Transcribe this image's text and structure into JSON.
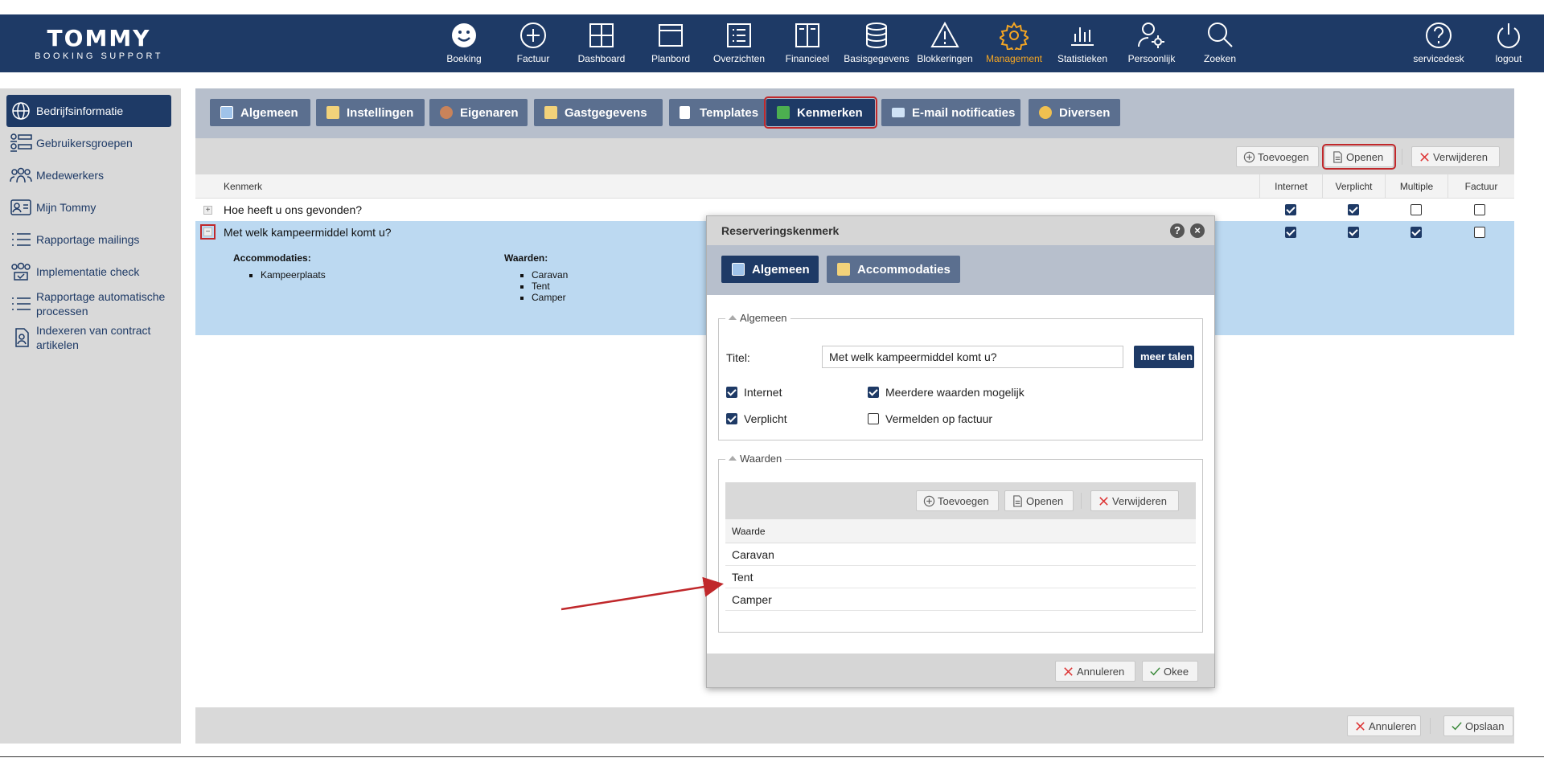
{
  "logo": {
    "main": "TOMMY",
    "sub": "BOOKING SUPPORT"
  },
  "nav": [
    {
      "label": "Boeking",
      "icon": "smiley-icon"
    },
    {
      "label": "Factuur",
      "icon": "plus-circle-icon"
    },
    {
      "label": "Dashboard",
      "icon": "grid-icon"
    },
    {
      "label": "Planbord",
      "icon": "board-icon"
    },
    {
      "label": "Overzichten",
      "icon": "list-icon"
    },
    {
      "label": "Financieel",
      "icon": "book-icon"
    },
    {
      "label": "Basisgegevens",
      "icon": "database-icon"
    },
    {
      "label": "Blokkeringen",
      "icon": "warning-icon"
    },
    {
      "label": "Management",
      "icon": "gear-icon"
    },
    {
      "label": "Statistieken",
      "icon": "bar-chart-icon"
    },
    {
      "label": "Persoonlijk",
      "icon": "user-gear-icon"
    },
    {
      "label": "Zoeken",
      "icon": "search-icon"
    }
  ],
  "nav_right": [
    {
      "label": "servicedesk",
      "icon": "help-icon"
    },
    {
      "label": "logout",
      "icon": "power-icon"
    }
  ],
  "active_color": "#f5a623",
  "brand_color": "#1e3a66",
  "sidebar": [
    {
      "label": "Bedrijfsinformatie",
      "icon": "globe-icon"
    },
    {
      "label": "Gebruikersgroepen",
      "icon": "user-groups-icon"
    },
    {
      "label": "Medewerkers",
      "icon": "people-icon"
    },
    {
      "label": "Mijn Tommy",
      "icon": "id-card-icon"
    },
    {
      "label": "Rapportage mailings",
      "icon": "list-icon"
    },
    {
      "label": "Implementatie check",
      "icon": "team-check-icon"
    },
    {
      "label": "Rapportage automatische processen",
      "icon": "list-icon"
    },
    {
      "label": "Indexeren van contract artikelen",
      "icon": "document-user-icon"
    }
  ],
  "tabs": [
    "Algemeen",
    "Instellingen",
    "Eigenaren",
    "Gastgegevens",
    "Templates",
    "Kenmerken",
    "E-mail notificaties",
    "Diversen"
  ],
  "toolbar": {
    "add": "Toevoegen",
    "open": "Openen",
    "delete": "Verwijderen"
  },
  "grid": {
    "headers": [
      "Kenmerk",
      "Internet",
      "Verplicht",
      "Multiple",
      "Factuur"
    ],
    "rows": [
      {
        "text": "Hoe heeft u ons gevonden?",
        "checks": [
          true,
          true,
          false,
          false
        ],
        "expander": "+"
      },
      {
        "text": "Met welk kampeermiddel komt u?",
        "checks": [
          true,
          true,
          true,
          false
        ],
        "expander": "−"
      }
    ],
    "detail": {
      "acc_title": "Accommodaties:",
      "acc_items": [
        "Kampeerplaats"
      ],
      "val_title": "Waarden:",
      "val_items": [
        "Caravan",
        "Tent",
        "Camper"
      ]
    }
  },
  "bottom": {
    "cancel": "Annuleren",
    "save": "Opslaan"
  },
  "dialog": {
    "title": "Reserveringskenmerk",
    "tabs": [
      "Algemeen",
      "Accommodaties"
    ],
    "section1": "Algemeen",
    "titel_label": "Titel:",
    "titel_value": "Met welk kampeermiddel komt u?",
    "meer_talen": "meer talen",
    "checks": [
      {
        "label": "Internet",
        "checked": true
      },
      {
        "label": "Meerdere waarden mogelijk",
        "checked": true
      },
      {
        "label": "Verplicht",
        "checked": true
      },
      {
        "label": "Vermelden op factuur",
        "checked": false
      }
    ],
    "section2": "Waarden",
    "toolbar": {
      "add": "Toevoegen",
      "open": "Openen",
      "delete": "Verwijderen"
    },
    "values_header": "Waarde",
    "values": [
      "Caravan",
      "Tent",
      "Camper"
    ],
    "cancel": "Annuleren",
    "ok": "Okee"
  }
}
